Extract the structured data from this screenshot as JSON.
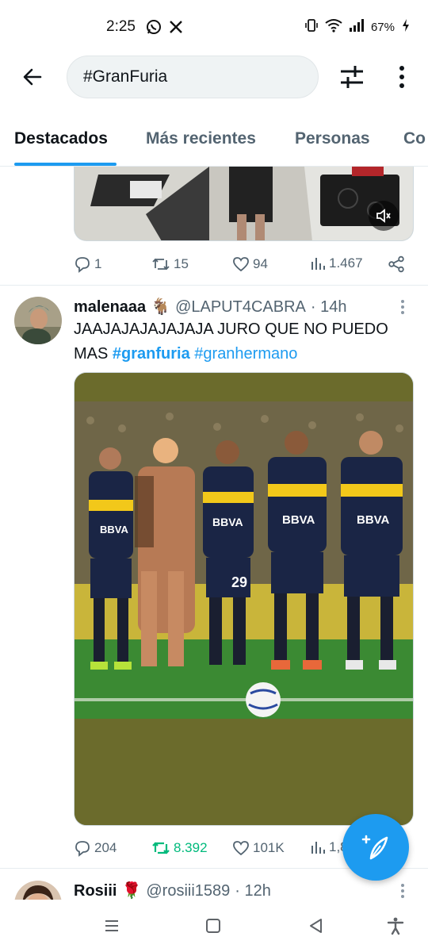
{
  "status_bar": {
    "time": "2:25",
    "battery": "67%",
    "app_icons": [
      "whatsapp-icon",
      "x-icon"
    ],
    "system_icons": [
      "vibrate-icon",
      "wifi-icon",
      "signal-icon",
      "battery-charging-icon"
    ]
  },
  "header": {
    "search_value": "#GranFuria",
    "back_icon": "arrow-left-icon",
    "filter_icon": "sliders-icon",
    "more_icon": "more-vertical-icon"
  },
  "tabs": [
    {
      "label": "Destacados",
      "active": true
    },
    {
      "label": "Más recientes",
      "active": false
    },
    {
      "label": "Personas",
      "active": false
    },
    {
      "label": "Co",
      "active": false
    }
  ],
  "prev_tweet": {
    "actions": {
      "replies": "1",
      "retweets": "15",
      "likes": "94",
      "views": "1.467"
    }
  },
  "tweet": {
    "display_name": "malenaaa",
    "emoji": "🐐",
    "handle": "@LAPUT4CABRA",
    "time": "· 14h",
    "text_main": "JAAJAJAJAJAJAJA JURO QUE NO PUEDO MAS",
    "hashtag_1": "#granfuria",
    "hashtag_2": "#granhermano",
    "actions": {
      "replies": "204",
      "retweets": "8.392",
      "likes": "101K",
      "views": "1,8"
    },
    "jersey_text": "BBVA",
    "number_29": "29",
    "retweet_color": "#00ba7c"
  },
  "next_tweet": {
    "display_name": "Rosiii",
    "emoji": "🌹",
    "handle": "@rosiii1589",
    "time": "· 12h"
  },
  "colors": {
    "accent": "#1d9bf0",
    "text": "#0f1419",
    "muted": "#536471"
  },
  "fab": {
    "icon": "compose-feather-icon"
  },
  "nav_bar": {
    "icons": [
      "recent-apps-icon",
      "home-icon",
      "back-triangle-icon",
      "accessibility-icon"
    ]
  }
}
